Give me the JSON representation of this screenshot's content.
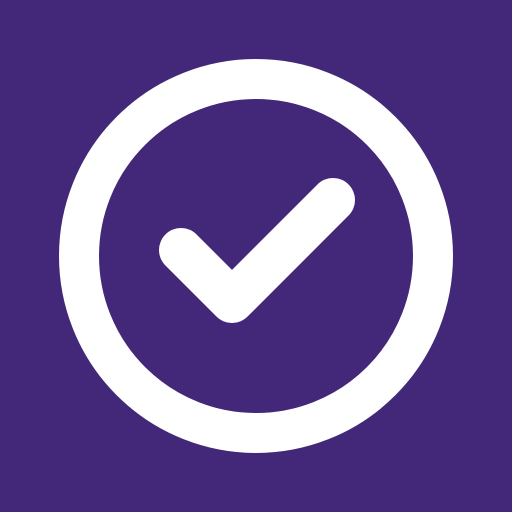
{
  "icon": {
    "name": "check-circle-icon",
    "background_color": "#43287A",
    "foreground_color": "#FFFFFF"
  }
}
